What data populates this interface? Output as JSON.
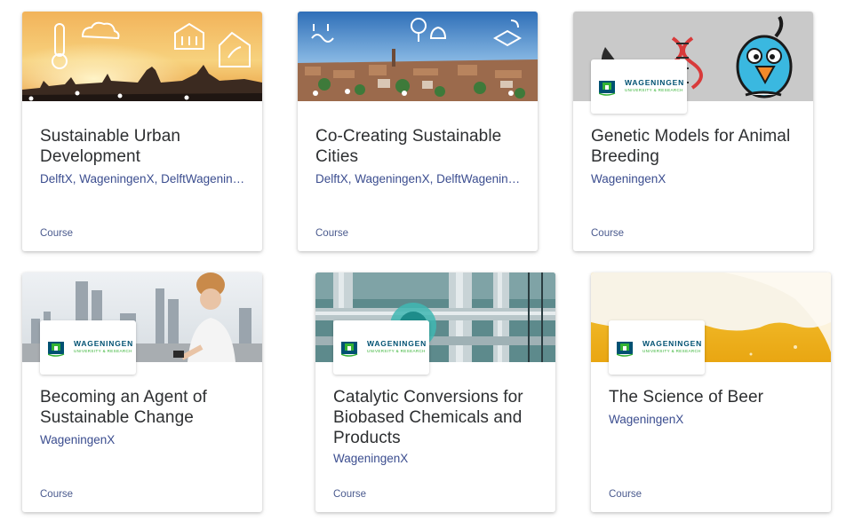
{
  "cards": [
    {
      "title": "Sustainable Urban Development",
      "org": "DelftX, WageningenX, DelftWageningenX",
      "type": "Course",
      "image": "city-sunset-icons"
    },
    {
      "title": "Co-Creating Sustainable Cities",
      "org": "DelftX, WageningenX, DelftWageningenX",
      "type": "Course",
      "image": "amsterdam-aerial-icons"
    },
    {
      "title": "Genetic Models for Animal Breeding",
      "org": "WageningenX",
      "type": "Course",
      "image": "cartoon-bird-dna",
      "logo_text": "WAGENINGEN",
      "logo_sub": "UNIVERSITY & RESEARCH"
    },
    {
      "title": "Becoming an Agent of Sustainable Change",
      "org": "WageningenX",
      "type": "Course",
      "image": "woman-city-skyline",
      "logo_text": "WAGENINGEN",
      "logo_sub": "UNIVERSITY & RESEARCH"
    },
    {
      "title": "Catalytic Conversions for Biobased Chemicals and Products",
      "org": "WageningenX",
      "type": "Course",
      "image": "industrial-pipes",
      "logo_text": "WAGENINGEN",
      "logo_sub": "UNIVERSITY & RESEARCH"
    },
    {
      "title": "The Science of Beer",
      "org": "WageningenX",
      "type": "Course",
      "image": "beer-foam",
      "logo_text": "WAGENINGEN",
      "logo_sub": "UNIVERSITY & RESEARCH"
    }
  ],
  "colors": {
    "title": "#2d2f31",
    "org": "#3b4d8f",
    "wur_green": "#34b233",
    "wur_blue": "#005172"
  }
}
